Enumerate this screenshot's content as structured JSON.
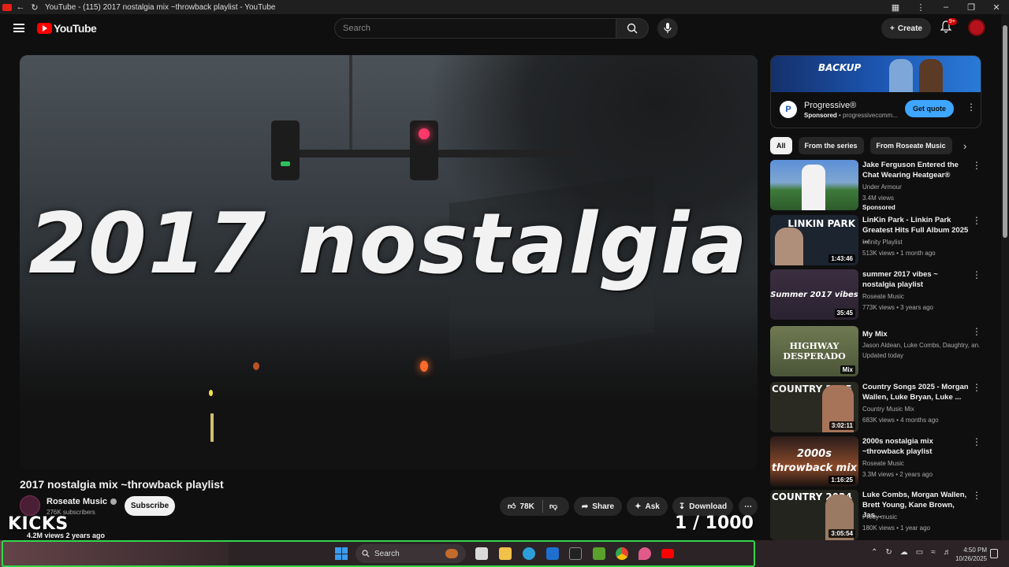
{
  "browser": {
    "tab_title": "YouTube - (115) 2017 nostalgia mix ~throwback playlist - YouTube"
  },
  "masthead": {
    "logo_text": "YouTube",
    "search_placeholder": "Search",
    "create_label": "Create",
    "notification_count": "9+"
  },
  "player": {
    "overlay_title": "2017 nostalgia",
    "corner_label": "KICKS",
    "counter": "1 / 1000"
  },
  "video": {
    "title": "2017 nostalgia mix ~throwback playlist",
    "channel": "Roseate Music",
    "subscribers": "276K subscribers",
    "subscribe_label": "Subscribe",
    "likes": "78K",
    "share_label": "Share",
    "ask_label": "Ask",
    "download_label": "Download",
    "views_line": "4.2M views  2 years ago"
  },
  "ad": {
    "banner_text": "BACKUP",
    "advertiser": "Progressive®",
    "sponsored_label": "Sponsored",
    "domain": "progressivecomm...",
    "cta": "Get quote"
  },
  "chips": [
    "All",
    "From the series",
    "From Roseate Music"
  ],
  "recommendations": [
    {
      "title": "Jake Ferguson Entered the Chat Wearing Heatgear®",
      "channel": "Under Armour",
      "meta": "3.4M views",
      "extra": "Sponsored",
      "duration": ""
    },
    {
      "title": "LinKin Park - Linkin Park Greatest Hits Full Album 2025 ...",
      "channel": "Infinity Playlist",
      "meta": "513K views • 1 month ago",
      "extra": "",
      "duration": "1:43:46",
      "thumb_text": "LINKIN PARK"
    },
    {
      "title": "summer 2017 vibes ~ nostalgia playlist",
      "channel": "Roseate Music",
      "meta": "773K views • 3 years ago",
      "extra": "",
      "duration": "35:45",
      "thumb_text": "Summer 2017 vibes"
    },
    {
      "title": "My Mix",
      "channel": "Jason Aldean, Luke Combs, Daughtry, an...",
      "meta": "Updated today",
      "extra": "",
      "duration": "Mix",
      "thumb_text": "HIGHWAY DESPERADO"
    },
    {
      "title": "Country Songs 2025 - Morgan Wallen, Luke Bryan, Luke ...",
      "channel": "Country Music Mix",
      "meta": "683K views • 4 months ago",
      "extra": "",
      "duration": "3:02:11",
      "thumb_text": "COUNTRY 2025"
    },
    {
      "title": "2000s nostalgia mix ~throwback playlist",
      "channel": "Roseate Music",
      "meta": "3.3M views • 2 years ago",
      "extra": "",
      "duration": "1:16:25",
      "thumb_text": "2000s throwback mix"
    },
    {
      "title": "Luke Combs, Morgan Wallen, Brett Young, Kane Brown, Jas...",
      "channel": "Pretty music",
      "meta": "180K views • 1 year ago",
      "extra": "",
      "duration": "3:05:54",
      "thumb_text": "COUNTRY 2024"
    }
  ],
  "taskbar": {
    "search_label": "Search",
    "time": "4:50 PM",
    "date": "10/26/2025"
  }
}
